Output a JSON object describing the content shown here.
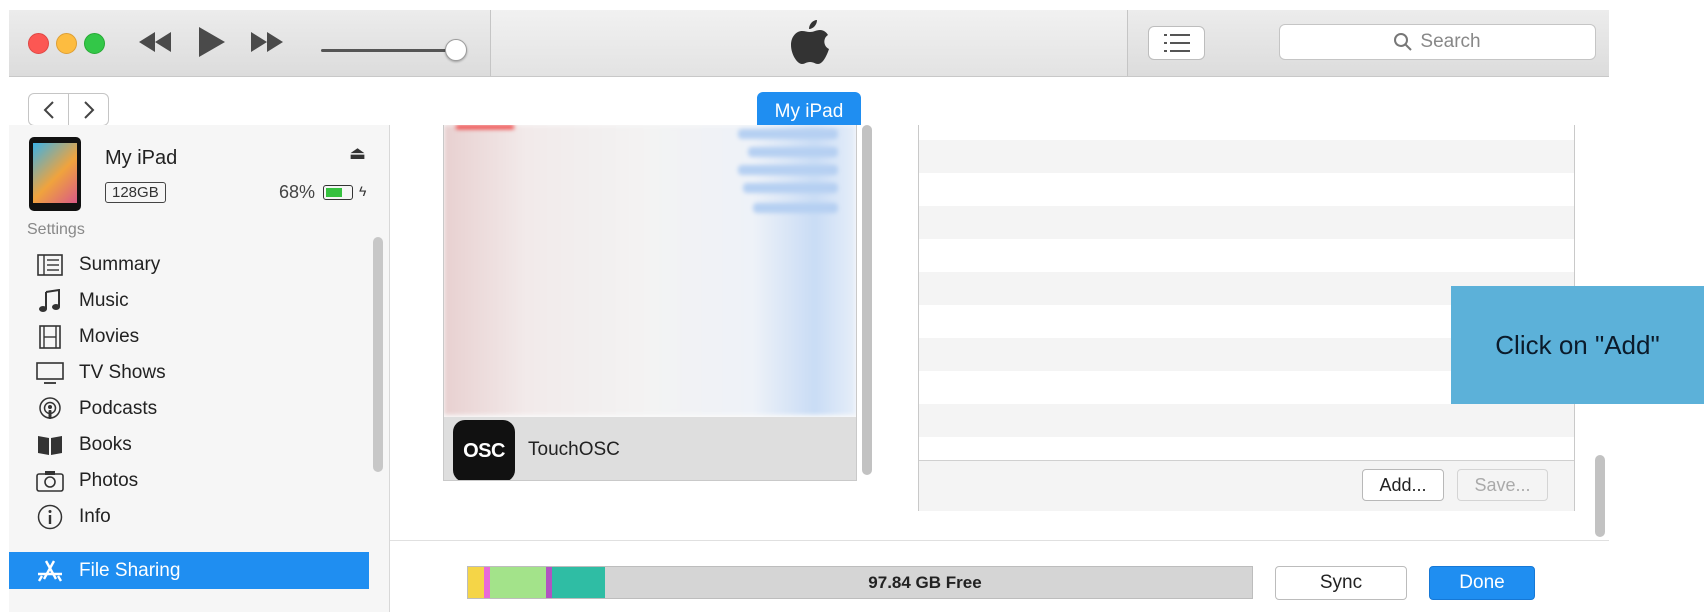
{
  "toolbar": {
    "search_placeholder": "Search"
  },
  "nav": {
    "device_pill": "My iPad"
  },
  "device": {
    "name": "My iPad",
    "capacity": "128GB",
    "battery": "68%",
    "battery_level": 0.68
  },
  "sidebar": {
    "section_label": "Settings",
    "items": [
      {
        "label": "Summary",
        "icon": "summary-icon"
      },
      {
        "label": "Music",
        "icon": "music-note-icon"
      },
      {
        "label": "Movies",
        "icon": "film-icon"
      },
      {
        "label": "TV Shows",
        "icon": "tv-icon"
      },
      {
        "label": "Podcasts",
        "icon": "podcast-icon"
      },
      {
        "label": "Books",
        "icon": "book-icon"
      },
      {
        "label": "Photos",
        "icon": "camera-icon"
      },
      {
        "label": "Info",
        "icon": "info-icon"
      },
      {
        "label": "File Sharing",
        "icon": "app-store-icon",
        "active": true
      }
    ]
  },
  "apps": {
    "app_name": "TouchOSC",
    "app_icon_text": "OSC"
  },
  "documents": {
    "add_label": "Add...",
    "save_label": "Save..."
  },
  "storage": {
    "free_label": "97.84 GB Free",
    "segments": [
      {
        "color": "#f5d547",
        "fraction": 0.02
      },
      {
        "color": "#e86ad8",
        "fraction": 0.008
      },
      {
        "color": "#a3e38a",
        "fraction": 0.072
      },
      {
        "color": "#b153c2",
        "fraction": 0.008
      },
      {
        "color": "#2fbda4",
        "fraction": 0.068
      }
    ]
  },
  "actions": {
    "sync_label": "Sync",
    "done_label": "Done"
  },
  "callout": {
    "text": "Click on \"Add\""
  },
  "colors": {
    "accent": "#1f8ef1",
    "callout": "#5cb1d9"
  }
}
